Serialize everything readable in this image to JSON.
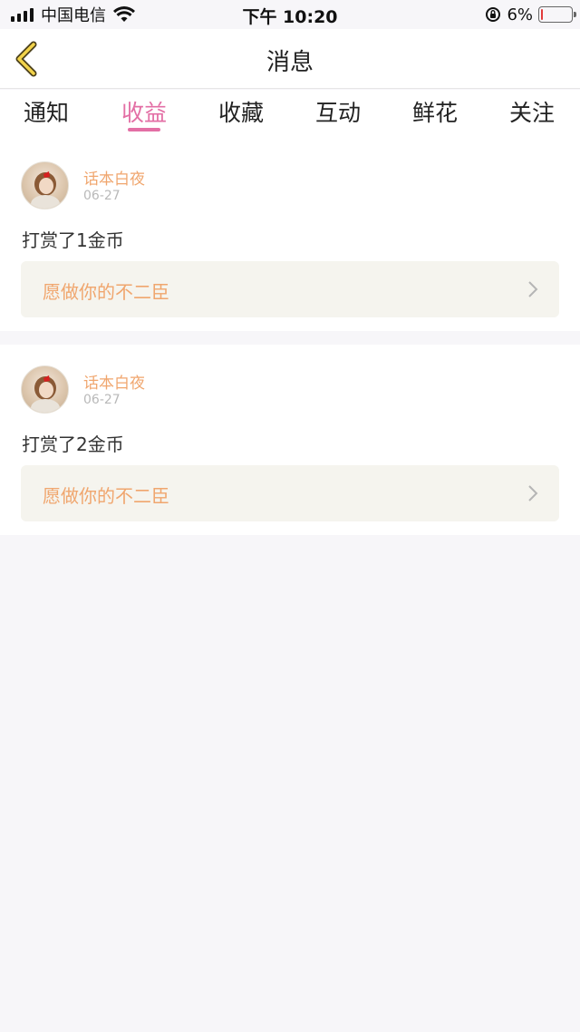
{
  "status_bar": {
    "carrier": "中国电信",
    "time": "下午 10:20",
    "battery_text": "6%",
    "battery_level": 0.06
  },
  "header": {
    "title": "消息"
  },
  "tabs": [
    {
      "label": "通知"
    },
    {
      "label": "收益",
      "active": true
    },
    {
      "label": "收藏"
    },
    {
      "label": "互动"
    },
    {
      "label": "鲜花"
    },
    {
      "label": "关注"
    }
  ],
  "messages": [
    {
      "user": "话本白夜",
      "date": "06-27",
      "text": "打赏了1金币",
      "book": "愿做你的不二臣"
    },
    {
      "user": "话本白夜",
      "date": "06-27",
      "text": "打赏了2金币",
      "book": "愿做你的不二臣"
    }
  ],
  "colors": {
    "accent": "#e36fa5",
    "username": "#f0a66e",
    "background": "#f7f6f9"
  }
}
